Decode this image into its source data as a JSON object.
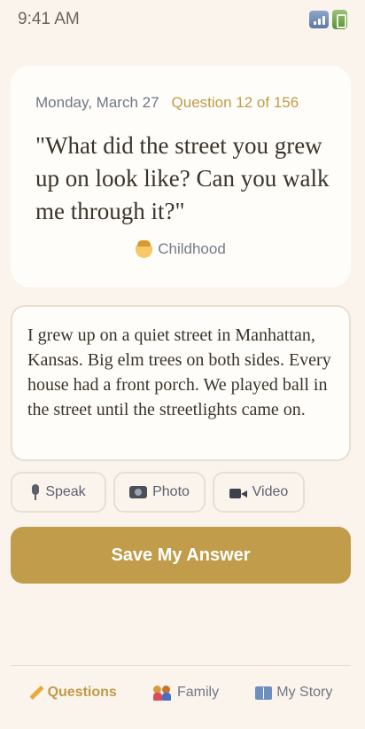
{
  "status_bar": {
    "time": "9:41 AM",
    "icons": [
      "signal-icon",
      "battery-icon"
    ]
  },
  "question_card": {
    "date": "Monday, March 27",
    "progress": "Question 12 of 156",
    "question": "\"What did the street you grew up on look like? Can you walk me through it?\"",
    "category_icon": "child-face-icon",
    "category": "Childhood"
  },
  "answer": {
    "text": "I grew up on a quiet street in Manhattan, Kansas. Big elm trees on both sides. Every house had a front porch. We played ball in the street until the streetlights came on."
  },
  "media_buttons": {
    "speak": {
      "icon": "microphone-icon",
      "label": "Speak"
    },
    "photo": {
      "icon": "camera-icon",
      "label": "Photo"
    },
    "video": {
      "icon": "video-camera-icon",
      "label": "Video"
    }
  },
  "save_button": {
    "label": "Save My Answer"
  },
  "bottom_nav": {
    "items": [
      {
        "icon": "pencil-icon",
        "label": "Questions",
        "active": true
      },
      {
        "icon": "family-icon",
        "label": "Family",
        "active": false
      },
      {
        "icon": "book-icon",
        "label": "My Story",
        "active": false
      }
    ]
  },
  "colors": {
    "background": "#fbf4ec",
    "card": "#fffdf9",
    "accent": "#c09c4b",
    "muted_text": "#707784"
  }
}
